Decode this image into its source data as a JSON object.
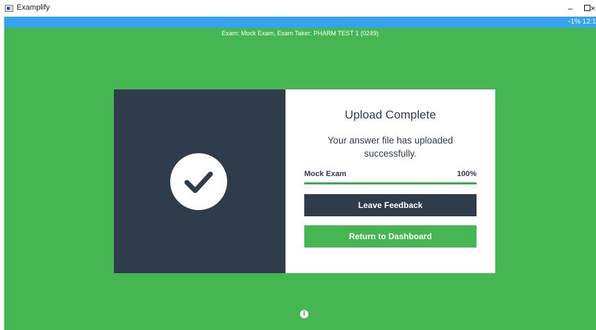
{
  "window": {
    "title": "Examplify",
    "minimize_glyph": "–",
    "close_glyph": "×"
  },
  "status": {
    "right_text": "-1% 12:1"
  },
  "exam_header": "Exam: Mock Exam, Exam Taker: PHARM TEST 1 (0249)",
  "card": {
    "title": "Upload Complete",
    "message": "Your answer file has uploaded successfully.",
    "progress": {
      "label": "Mock Exam",
      "percent_text": "100%",
      "value": 1.0
    },
    "feedback_button": "Leave Feedback",
    "dashboard_button": "Return to Dashboard"
  },
  "icons": {
    "app": "examplify-app-icon",
    "check": "checkmark-icon",
    "info": "info-icon"
  },
  "colors": {
    "stage_green": "#46b653",
    "dark_navy": "#2f3c4c",
    "status_blue": "#36a3ec",
    "progress_green": "#3cab49"
  },
  "info_glyph": "i"
}
